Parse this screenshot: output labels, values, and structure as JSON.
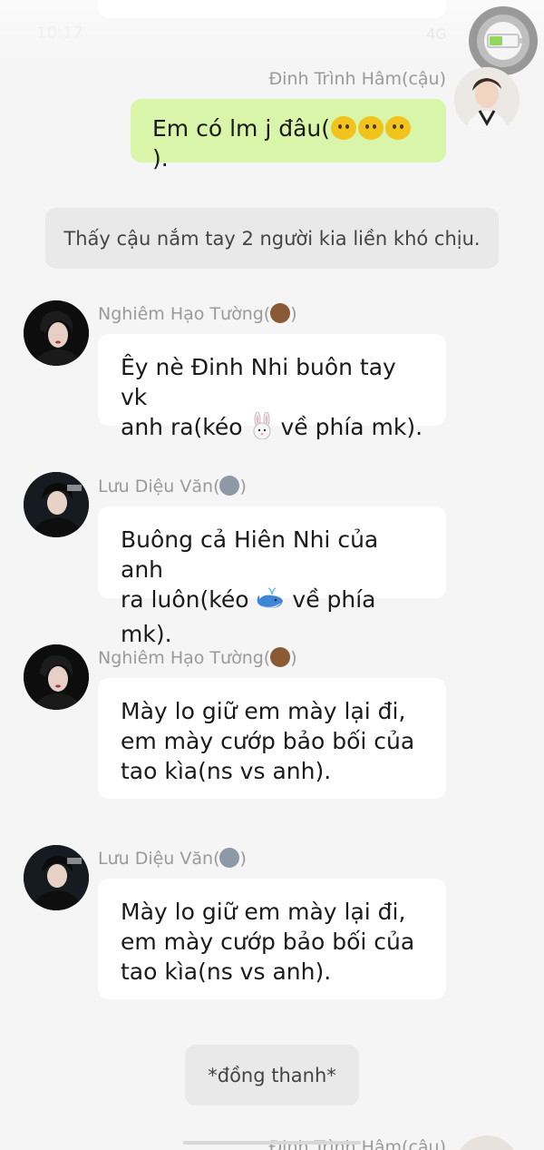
{
  "status": {
    "time": "10:17",
    "right": "4G"
  },
  "messages": [
    {
      "sender": "Đinh Trình Hâm(cậu)",
      "text_prefix": "Em có lm j đâu(",
      "text_suffix": ")."
    },
    {
      "narration": "Thấy cậu nắm tay 2 người kia liền khó chịu."
    },
    {
      "sender": "Nghiêm Hạo Tường(",
      "sender_suffix": ")",
      "line1": "Êy nè Đinh Nhi buôn tay vk",
      "line2_a": "anh ra(kéo ",
      "line2_b": " về phía mk)."
    },
    {
      "sender": "Lưu Diệu Văn(",
      "sender_suffix": ")",
      "line1": "Buông cả Hiên Nhi của anh",
      "line2_a": "ra luôn(kéo ",
      "line2_b": " về phía mk)."
    },
    {
      "sender": "Nghiêm Hạo Tường(",
      "sender_suffix": ")",
      "line1": "Mày lo giữ em mày lại đi,",
      "line2": "em mày cướp bảo bối của",
      "line3": "tao kìa(ns vs anh)."
    },
    {
      "sender": "Lưu Diệu Văn(",
      "sender_suffix": ")",
      "line1": "Mày lo giữ em mày lại đi,",
      "line2": "em mày cướp bảo bối của",
      "line3": "tao kìa(ns vs anh)."
    },
    {
      "narration": "*đồng thanh*"
    },
    {
      "sender": "Đinh Trình Hâm(cậu)"
    }
  ],
  "icons": {
    "bear": "bear-face-emoji",
    "wolf": "wolf-face-emoji",
    "rabbit": "rabbit-face-emoji",
    "whale": "whale-emoji",
    "chick": "hatching-chick-emoji"
  },
  "colors": {
    "background": "#f5f5f5",
    "bubble": "#ffffff",
    "bubble_self": "#d9f5a9",
    "narration": "#e9e9e9",
    "name": "#9a9a9a"
  }
}
